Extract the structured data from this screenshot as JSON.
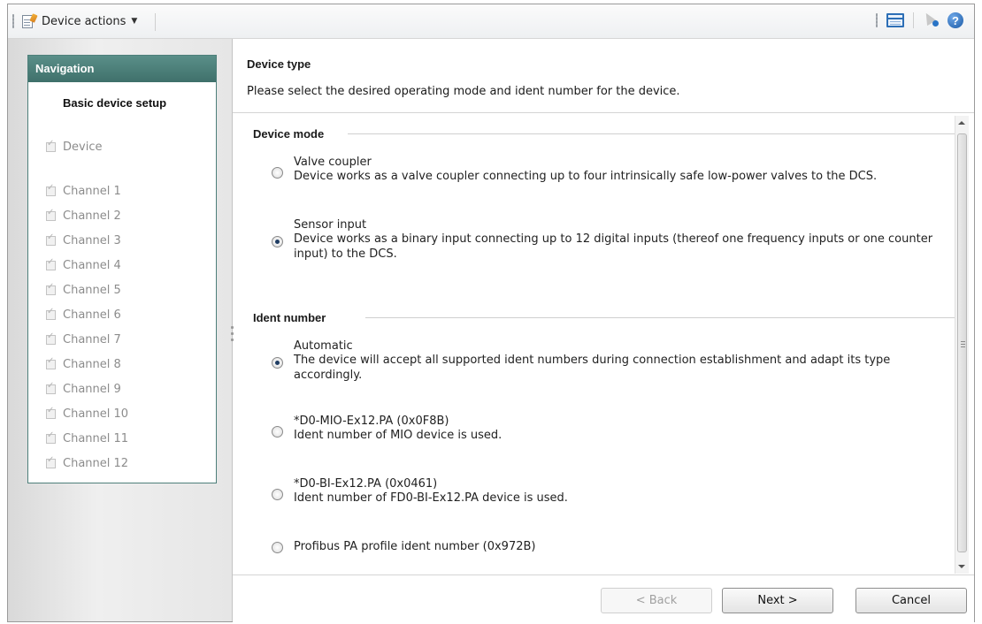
{
  "toolbar": {
    "device_actions_label": "Device actions",
    "icons": [
      "document-edit-icon",
      "window-layout-icon",
      "context-help-icon",
      "help-icon"
    ],
    "help_glyph": "?"
  },
  "navigation": {
    "header": "Navigation",
    "title": "Basic device setup",
    "items": [
      {
        "label": "Device"
      },
      {
        "label": "Channel 1"
      },
      {
        "label": "Channel 2"
      },
      {
        "label": "Channel 3"
      },
      {
        "label": "Channel 4"
      },
      {
        "label": "Channel 5"
      },
      {
        "label": "Channel 6"
      },
      {
        "label": "Channel 7"
      },
      {
        "label": "Channel 8"
      },
      {
        "label": "Channel 9"
      },
      {
        "label": "Channel 10"
      },
      {
        "label": "Channel 11"
      },
      {
        "label": "Channel 12"
      }
    ]
  },
  "page": {
    "title": "Device type",
    "description": "Please select the desired operating mode and ident number for the device."
  },
  "device_mode": {
    "title": "Device mode",
    "options": [
      {
        "title": "Valve coupler",
        "desc": "Device works as a valve coupler connecting up to four intrinsically safe low-power valves to the DCS.",
        "checked": false
      },
      {
        "title": "Sensor input",
        "desc": "Device works as a binary input connecting up to 12 digital inputs (thereof one frequency inputs or one counter input) to the DCS.",
        "checked": true
      }
    ]
  },
  "ident_number": {
    "title": "Ident number",
    "options": [
      {
        "title": "Automatic",
        "desc": "The device will accept all supported ident numbers during connection establishment and adapt its type accordingly.",
        "checked": true
      },
      {
        "title": "*D0-MIO-Ex12.PA (0x0F8B)",
        "desc": "Ident number of MIO device is used.",
        "checked": false
      },
      {
        "title": "*D0-BI-Ex12.PA (0x0461)",
        "desc": "Ident number of FD0-BI-Ex12.PA device is used.",
        "checked": false
      },
      {
        "title": "Profibus PA profile ident number (0x972B)",
        "desc": "",
        "checked": false
      }
    ]
  },
  "footer": {
    "back_label": "< Back",
    "next_label": "Next >",
    "cancel_label": "Cancel"
  },
  "colors": {
    "nav_header": "#4a7d77",
    "accent_blue": "#2d6fb6"
  }
}
